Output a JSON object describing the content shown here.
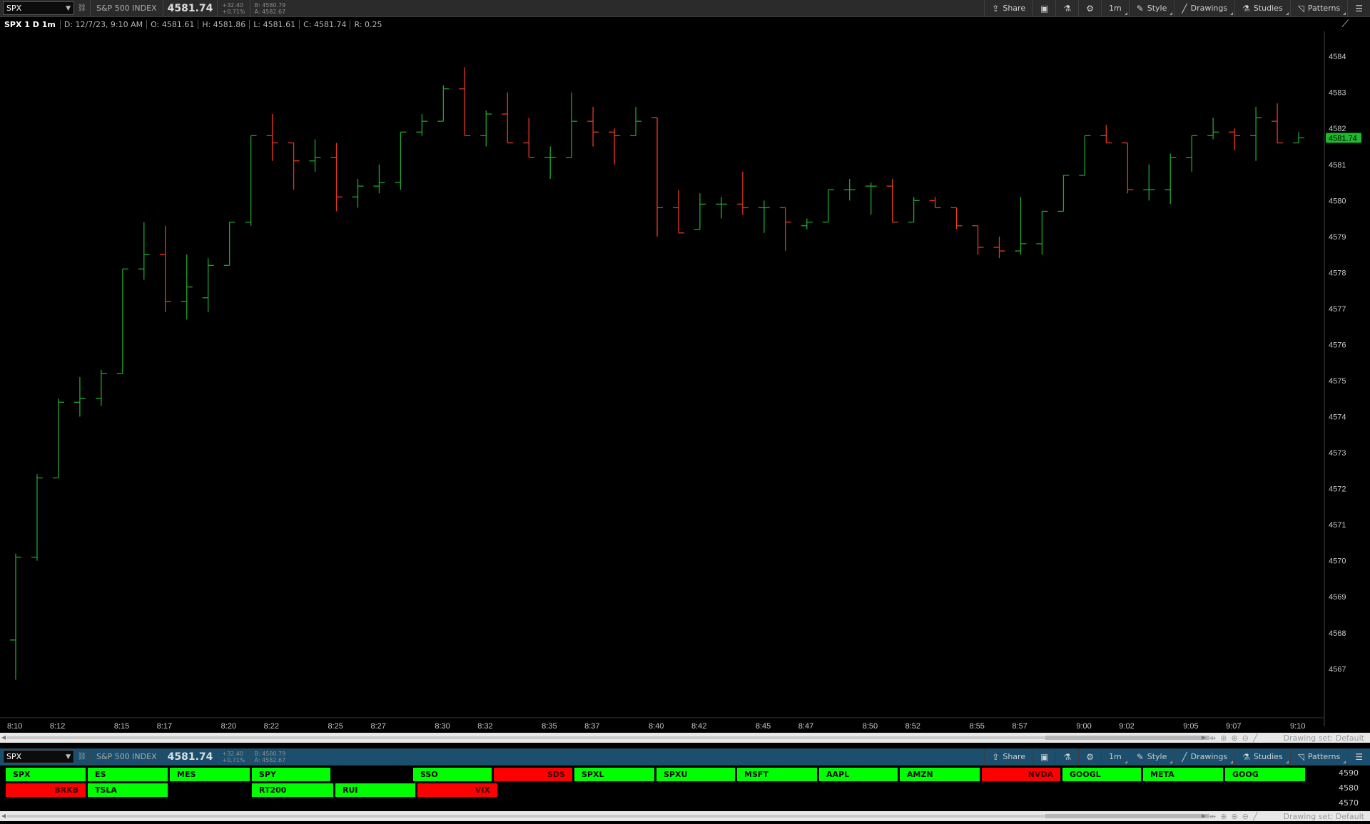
{
  "top_toolbar": {
    "symbol": "SPX",
    "index_name": "S&P 500 INDEX",
    "last": "4581.74",
    "change": "+32.40",
    "change_pct": "+0.71%",
    "bid": "B: 4580.79",
    "ask": "A: 4582.67",
    "share_label": "Share",
    "interval_label": "1m",
    "style_label": "Style",
    "drawings_label": "Drawings",
    "studies_label": "Studies",
    "patterns_label": "Patterns"
  },
  "chart_info": {
    "title": "SPX 1 D 1m",
    "date": "D: 12/7/23, 9:10 AM",
    "open": "O: 4581.61",
    "high": "H: 4581.86",
    "low": "L: 4581.61",
    "close": "C: 4581.74",
    "range": "R: 0.25"
  },
  "price_tag": "4581.74",
  "drawing_set": "Drawing set: Default",
  "bottom_toolbar": {
    "symbol": "SPX",
    "index_name": "S&P 500 INDEX",
    "last": "4581.74",
    "change": "+32.40",
    "change_pct": "+0.71%",
    "bid": "B: 4580.79",
    "ask": "A: 4582.67",
    "share_label": "Share",
    "interval_label": "1m",
    "style_label": "Style",
    "drawings_label": "Drawings",
    "studies_label": "Studies",
    "patterns_label": "Patterns"
  },
  "watchlist": {
    "row1": [
      {
        "symbol": "SPX",
        "dir": "up"
      },
      {
        "symbol": "ES",
        "dir": "up"
      },
      {
        "symbol": "MES",
        "dir": "up"
      },
      {
        "symbol": "SPY",
        "dir": "up"
      },
      {
        "symbol": "",
        "dir": "none"
      },
      {
        "symbol": "SSO",
        "dir": "up"
      },
      {
        "symbol": "SDS",
        "dir": "down"
      },
      {
        "symbol": "SPXL",
        "dir": "up"
      },
      {
        "symbol": "SPXU",
        "dir": "up"
      },
      {
        "symbol": "MSFT",
        "dir": "up"
      },
      {
        "symbol": "AAPL",
        "dir": "up"
      },
      {
        "symbol": "AMZN",
        "dir": "up"
      },
      {
        "symbol": "NVDA",
        "dir": "down"
      },
      {
        "symbol": "GOOGL",
        "dir": "up"
      },
      {
        "symbol": "META",
        "dir": "up"
      },
      {
        "symbol": "GOOG",
        "dir": "up"
      }
    ],
    "row2": [
      {
        "symbol": "BRKB",
        "dir": "down"
      },
      {
        "symbol": "TSLA",
        "dir": "up"
      },
      {
        "symbol": "",
        "dir": "none"
      },
      {
        "symbol": "RT200",
        "dir": "up"
      },
      {
        "symbol": "RUI",
        "dir": "up"
      },
      {
        "symbol": "VIX",
        "dir": "down"
      }
    ]
  },
  "mini_axis": [
    "4590",
    "4580",
    "4570"
  ],
  "colors": {
    "up": "#00ff00",
    "down": "#ff0000",
    "candle_up": "#21a52f",
    "candle_down": "#e8391f",
    "price_tag_bg": "#1fb82e"
  },
  "chart_data": {
    "type": "ohlc",
    "ylim": [
      4566,
      4584
    ],
    "yticks": [
      4567,
      4568,
      4569,
      4570,
      4571,
      4572,
      4573,
      4574,
      4575,
      4576,
      4577,
      4578,
      4579,
      4580,
      4581,
      4582,
      4583,
      4584
    ],
    "xticks": [
      "8:10",
      "8:12",
      "8:15",
      "8:17",
      "8:20",
      "8:22",
      "8:25",
      "8:27",
      "8:30",
      "8:32",
      "8:35",
      "8:37",
      "8:40",
      "8:42",
      "8:45",
      "8:47",
      "8:50",
      "8:52",
      "8:55",
      "8:57",
      "9:00",
      "9:02",
      "9:05",
      "9:07",
      "9:10"
    ],
    "bars": [
      [
        4567.8,
        4570.2,
        4566.7,
        4570.1
      ],
      [
        4570.1,
        4572.4,
        4570.0,
        4572.3
      ],
      [
        4572.3,
        4574.5,
        4572.3,
        4574.4
      ],
      [
        4574.4,
        4575.1,
        4574.0,
        4574.5
      ],
      [
        4574.5,
        4575.3,
        4574.3,
        4575.2
      ],
      [
        4575.2,
        4578.1,
        4575.2,
        4578.1
      ],
      [
        4578.1,
        4579.4,
        4577.8,
        4578.5
      ],
      [
        4578.5,
        4579.3,
        4576.9,
        4577.2
      ],
      [
        4577.2,
        4578.5,
        4576.7,
        4577.6
      ],
      [
        4577.3,
        4578.4,
        4576.9,
        4578.2
      ],
      [
        4578.2,
        4579.4,
        4578.2,
        4579.4
      ],
      [
        4579.4,
        4581.8,
        4579.3,
        4581.8
      ],
      [
        4581.8,
        4582.4,
        4581.1,
        4581.6
      ],
      [
        4581.6,
        4581.6,
        4580.3,
        4581.1
      ],
      [
        4581.1,
        4581.7,
        4580.8,
        4581.2
      ],
      [
        4581.2,
        4581.6,
        4579.7,
        4580.1
      ],
      [
        4580.1,
        4580.6,
        4579.8,
        4580.4
      ],
      [
        4580.4,
        4581.0,
        4580.2,
        4580.5
      ],
      [
        4580.5,
        4581.9,
        4580.3,
        4581.9
      ],
      [
        4581.9,
        4582.4,
        4581.8,
        4582.2
      ],
      [
        4582.2,
        4583.2,
        4582.2,
        4583.1
      ],
      [
        4583.1,
        4583.7,
        4581.8,
        4581.8
      ],
      [
        4581.8,
        4582.5,
        4581.5,
        4582.4
      ],
      [
        4582.4,
        4583.0,
        4581.6,
        4581.6
      ],
      [
        4581.6,
        4582.3,
        4581.2,
        4581.2
      ],
      [
        4581.2,
        4581.5,
        4580.6,
        4581.2
      ],
      [
        4581.2,
        4583.0,
        4581.2,
        4582.2
      ],
      [
        4582.2,
        4582.6,
        4581.5,
        4581.9
      ],
      [
        4581.9,
        4582.0,
        4581.0,
        4581.8
      ],
      [
        4581.8,
        4582.6,
        4581.8,
        4582.2
      ],
      [
        4582.3,
        4582.3,
        4579.0,
        4579.8
      ],
      [
        4579.8,
        4580.3,
        4579.1,
        4579.1
      ],
      [
        4579.2,
        4580.2,
        4579.2,
        4579.9
      ],
      [
        4579.9,
        4580.1,
        4579.5,
        4579.9
      ],
      [
        4579.9,
        4580.8,
        4579.6,
        4579.8
      ],
      [
        4579.8,
        4580.0,
        4579.1,
        4579.8
      ],
      [
        4579.8,
        4579.8,
        4578.6,
        4579.4
      ],
      [
        4579.3,
        4579.5,
        4579.2,
        4579.4
      ],
      [
        4579.4,
        4580.3,
        4579.4,
        4580.3
      ],
      [
        4580.3,
        4580.6,
        4580.0,
        4580.3
      ],
      [
        4580.4,
        4580.5,
        4579.6,
        4580.4
      ],
      [
        4580.4,
        4580.6,
        4579.4,
        4579.4
      ],
      [
        4579.4,
        4580.1,
        4579.4,
        4580.0
      ],
      [
        4580.0,
        4580.1,
        4579.8,
        4579.8
      ],
      [
        4579.8,
        4579.8,
        4579.2,
        4579.3
      ],
      [
        4579.3,
        4579.3,
        4578.5,
        4578.7
      ],
      [
        4578.7,
        4579.0,
        4578.4,
        4578.6
      ],
      [
        4578.6,
        4580.1,
        4578.5,
        4578.8
      ],
      [
        4578.8,
        4579.7,
        4578.5,
        4579.7
      ],
      [
        4579.7,
        4580.7,
        4579.7,
        4580.7
      ],
      [
        4580.7,
        4581.8,
        4580.7,
        4581.8
      ],
      [
        4581.8,
        4582.1,
        4581.6,
        4581.6
      ],
      [
        4581.6,
        4581.6,
        4580.2,
        4580.3
      ],
      [
        4580.3,
        4581.0,
        4580.0,
        4580.3
      ],
      [
        4580.3,
        4581.3,
        4579.9,
        4581.2
      ],
      [
        4581.2,
        4581.8,
        4580.8,
        4581.8
      ],
      [
        4581.8,
        4582.3,
        4581.7,
        4581.9
      ],
      [
        4581.9,
        4582.0,
        4581.4,
        4581.8
      ],
      [
        4581.8,
        4582.6,
        4581.1,
        4582.3
      ],
      [
        4582.2,
        4582.7,
        4581.6,
        4581.6
      ],
      [
        4581.6,
        4581.9,
        4581.6,
        4581.74
      ]
    ]
  }
}
